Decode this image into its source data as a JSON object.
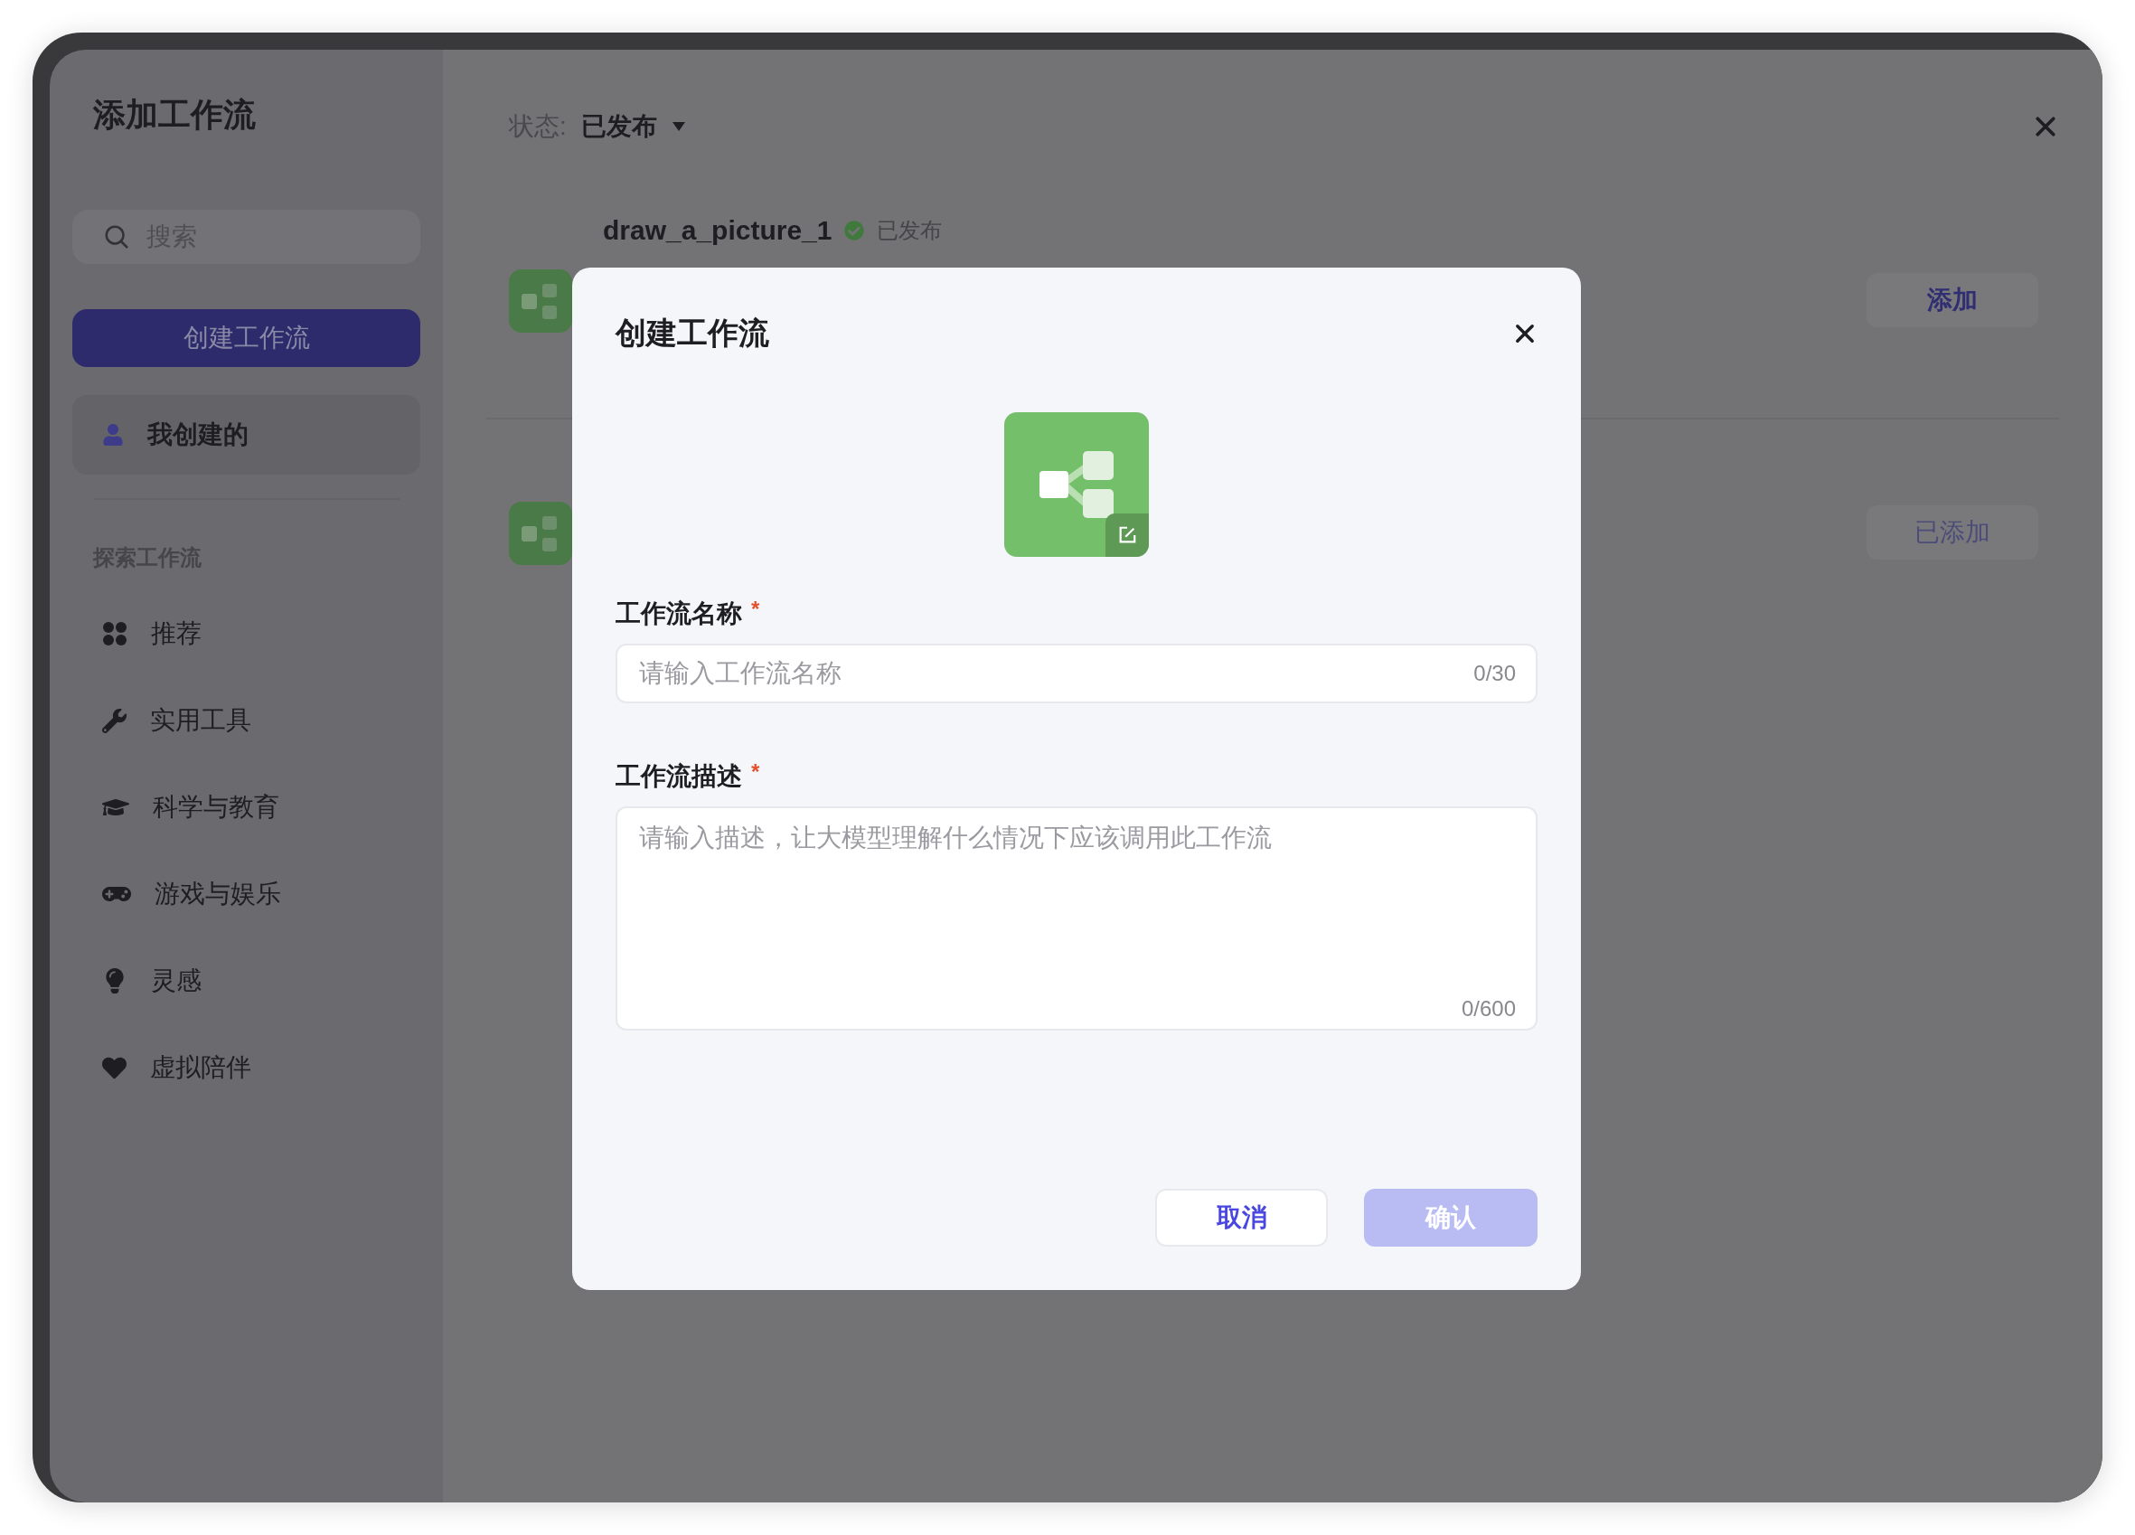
{
  "sidebar": {
    "title": "添加工作流",
    "search": {
      "placeholder": "搜索"
    },
    "create_button": "创建工作流",
    "mine": {
      "label": "我创建的",
      "selected": true
    },
    "section_label": "探索工作流",
    "items": [
      {
        "label": "推荐",
        "selected": false
      },
      {
        "label": "实用工具",
        "selected": false
      },
      {
        "label": "科学与教育",
        "selected": false
      },
      {
        "label": "游戏与娱乐",
        "selected": false
      },
      {
        "label": "灵感",
        "selected": false
      },
      {
        "label": "虚拟陪伴",
        "selected": false
      }
    ]
  },
  "filter": {
    "label": "状态:",
    "value": "已发布"
  },
  "workflows": [
    {
      "name": "draw_a_picture_1",
      "status": "已发布",
      "button": "添加",
      "disabled": false
    },
    {
      "button": "已添加",
      "disabled": true
    }
  ],
  "dialog": {
    "title": "创建工作流",
    "fields": [
      {
        "kind": "input",
        "label": "工作流名称",
        "required_mark": "*",
        "placeholder": "请输入工作流名称",
        "counter": "0/30"
      },
      {
        "kind": "textarea",
        "label": "工作流描述",
        "required_mark": "*",
        "placeholder": "请输入描述，让大模型理解什么情况下应该调用此工作流",
        "counter": "0/600"
      }
    ],
    "buttons": [
      {
        "label": "取消",
        "kind": "secondary",
        "disabled": false
      },
      {
        "label": "确认",
        "kind": "primary",
        "disabled": true
      }
    ]
  }
}
